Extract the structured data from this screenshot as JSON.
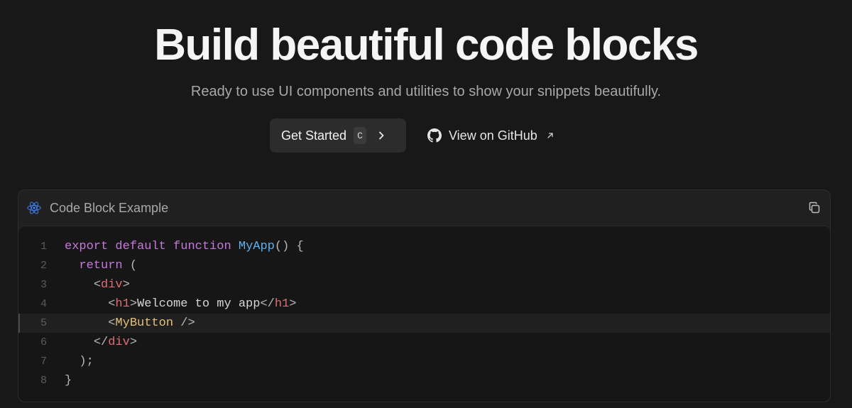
{
  "hero": {
    "title": "Build beautiful code blocks",
    "subtitle": "Ready to use UI components and utilities to show your snippets beautifully."
  },
  "cta": {
    "primary_label": "Get Started",
    "primary_shortcut": "C",
    "secondary_label": "View on GitHub"
  },
  "code_block": {
    "title": "Code Block Example",
    "highlighted_line": 5,
    "lines": [
      {
        "n": "1",
        "tokens": [
          [
            "kw",
            "export"
          ],
          [
            "t",
            " "
          ],
          [
            "kw",
            "default"
          ],
          [
            "t",
            " "
          ],
          [
            "kw",
            "function"
          ],
          [
            "t",
            " "
          ],
          [
            "fn",
            "MyApp"
          ],
          [
            "p",
            "() {"
          ]
        ]
      },
      {
        "n": "2",
        "tokens": [
          [
            "t",
            "  "
          ],
          [
            "kw",
            "return"
          ],
          [
            "p",
            " ("
          ]
        ]
      },
      {
        "n": "3",
        "tokens": [
          [
            "t",
            "    "
          ],
          [
            "p",
            "<"
          ],
          [
            "tag",
            "div"
          ],
          [
            "p",
            ">"
          ]
        ]
      },
      {
        "n": "4",
        "tokens": [
          [
            "t",
            "      "
          ],
          [
            "p",
            "<"
          ],
          [
            "tag",
            "h1"
          ],
          [
            "p",
            ">"
          ],
          [
            "t",
            "Welcome to my app"
          ],
          [
            "p",
            "</"
          ],
          [
            "tag",
            "h1"
          ],
          [
            "p",
            ">"
          ]
        ]
      },
      {
        "n": "5",
        "tokens": [
          [
            "t",
            "      "
          ],
          [
            "p",
            "<"
          ],
          [
            "comp",
            "MyButton"
          ],
          [
            "p",
            " />"
          ]
        ]
      },
      {
        "n": "6",
        "tokens": [
          [
            "t",
            "    "
          ],
          [
            "p",
            "</"
          ],
          [
            "tag",
            "div"
          ],
          [
            "p",
            ">"
          ]
        ]
      },
      {
        "n": "7",
        "tokens": [
          [
            "p",
            "  );"
          ]
        ]
      },
      {
        "n": "8",
        "tokens": [
          [
            "p",
            "}"
          ]
        ]
      }
    ]
  },
  "colors": {
    "background": "#181818",
    "keyword": "#c678dd",
    "function": "#61afef",
    "tag": "#e06c75",
    "component": "#e5c07b",
    "react_icon": "#3b82f6"
  },
  "icons": {
    "code_lang": "react-icon",
    "copy": "copy-icon",
    "github": "github-icon",
    "external": "arrow-up-right-icon",
    "chevron": "chevron-right-icon"
  }
}
